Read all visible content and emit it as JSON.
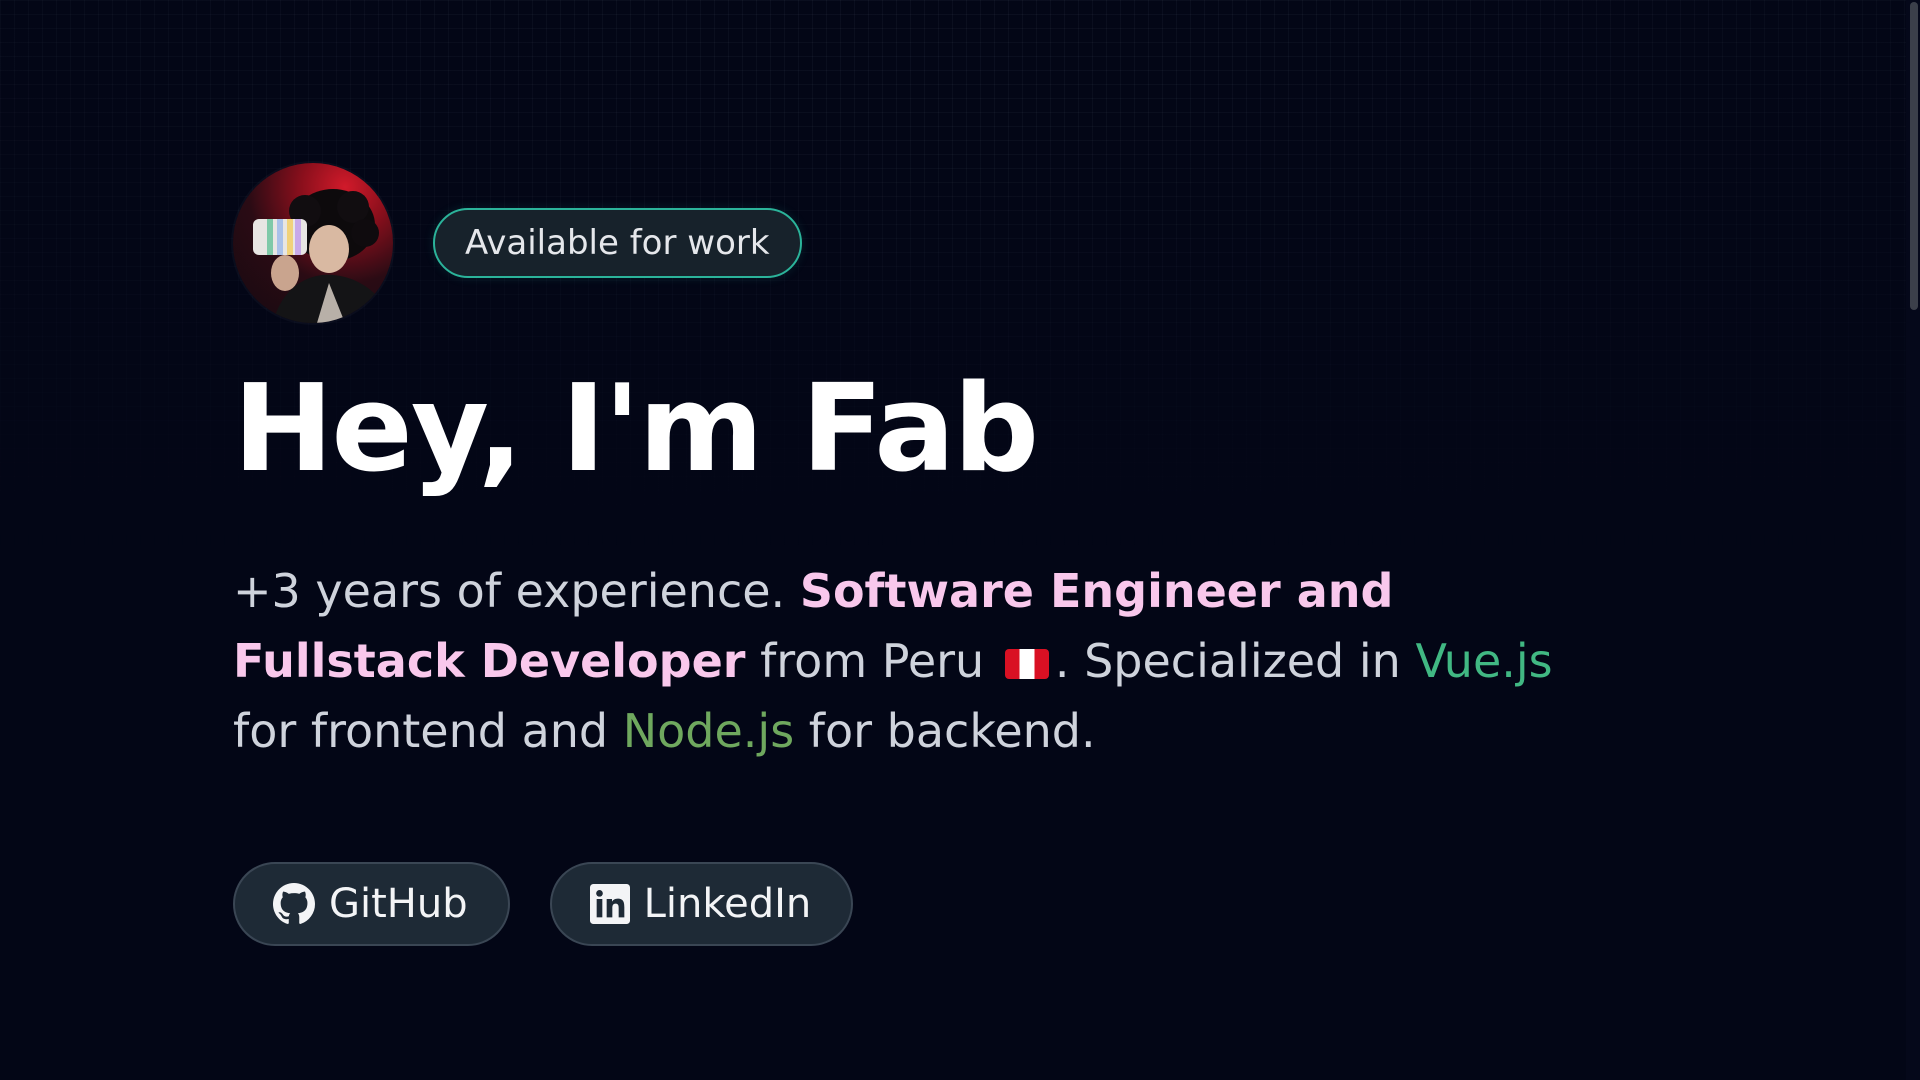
{
  "header": {
    "availability_badge": "Available for work"
  },
  "hero": {
    "title": "Hey, I'm Fab",
    "bio": {
      "part1": "+3 years of experience. ",
      "role": "Software Engineer and Fullstack Developer",
      "part2": " from Peru ",
      "part3": ". Specialized in ",
      "frontend_tech": "Vue.js",
      "part4": " for frontend and ",
      "backend_tech": "Node.js",
      "part5": " for backend."
    }
  },
  "links": [
    {
      "label": "GitHub",
      "icon": "github-icon"
    },
    {
      "label": "LinkedIn",
      "icon": "linkedin-icon"
    }
  ],
  "colors": {
    "background": "#030616",
    "badge_border": "#2bb39a",
    "role_highlight": "#f9c8ec",
    "vue_green": "#41b883",
    "node_green": "#6fa85e"
  }
}
